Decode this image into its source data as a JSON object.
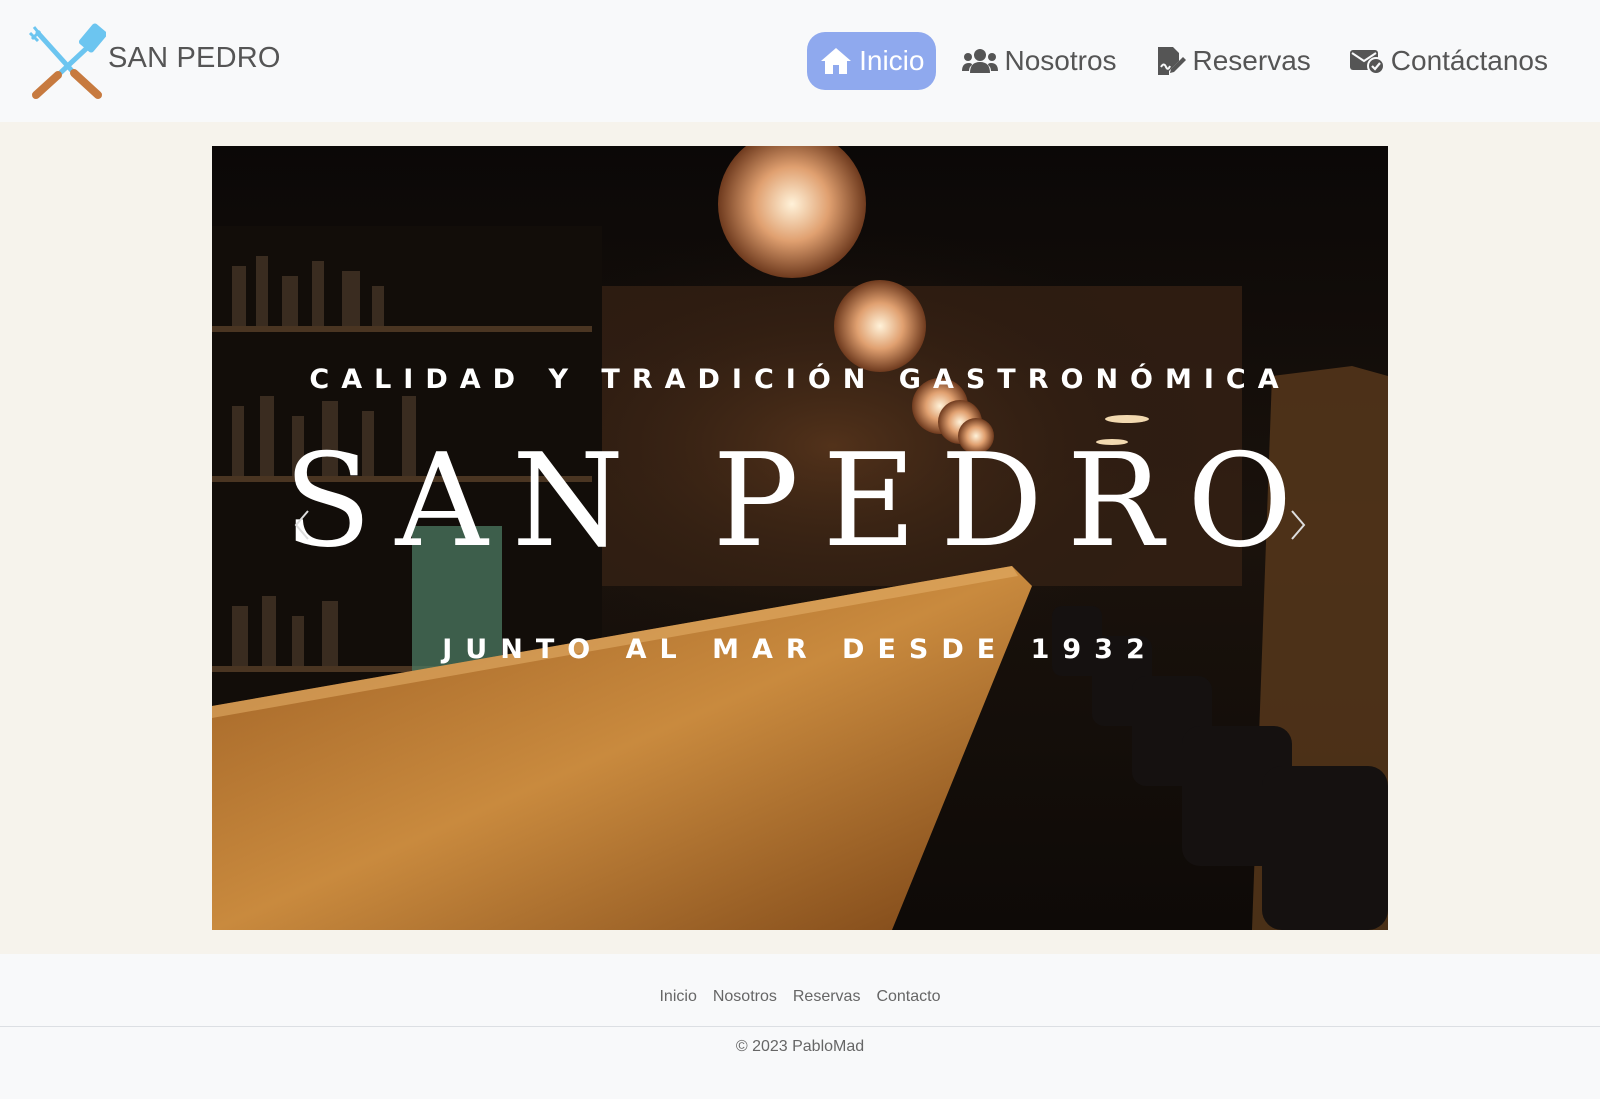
{
  "brand": {
    "name": "SAN PEDRO",
    "logo_icon": "utensils-crossed-icon"
  },
  "nav": {
    "items": [
      {
        "label": "Inicio",
        "icon": "home-icon",
        "active": true
      },
      {
        "label": "Nosotros",
        "icon": "users-icon",
        "active": false
      },
      {
        "label": "Reservas",
        "icon": "file-signature-icon",
        "active": false
      },
      {
        "label": "Contáctanos",
        "icon": "envelope-check-icon",
        "active": false
      }
    ]
  },
  "hero": {
    "tagline": "CALIDAD Y TRADICIÓN GASTRONÓMICA",
    "title": "SAN PEDRO",
    "subtitle": "JUNTO AL MAR DESDE 1932"
  },
  "footer": {
    "links": [
      "Inicio",
      "Nosotros",
      "Reservas",
      "Contacto"
    ],
    "copyright": "© 2023 PabloMad"
  },
  "colors": {
    "active_nav": "#8fa9ee",
    "navbar_bg": "#f8f9fa",
    "main_bg": "#f6f3ec"
  }
}
